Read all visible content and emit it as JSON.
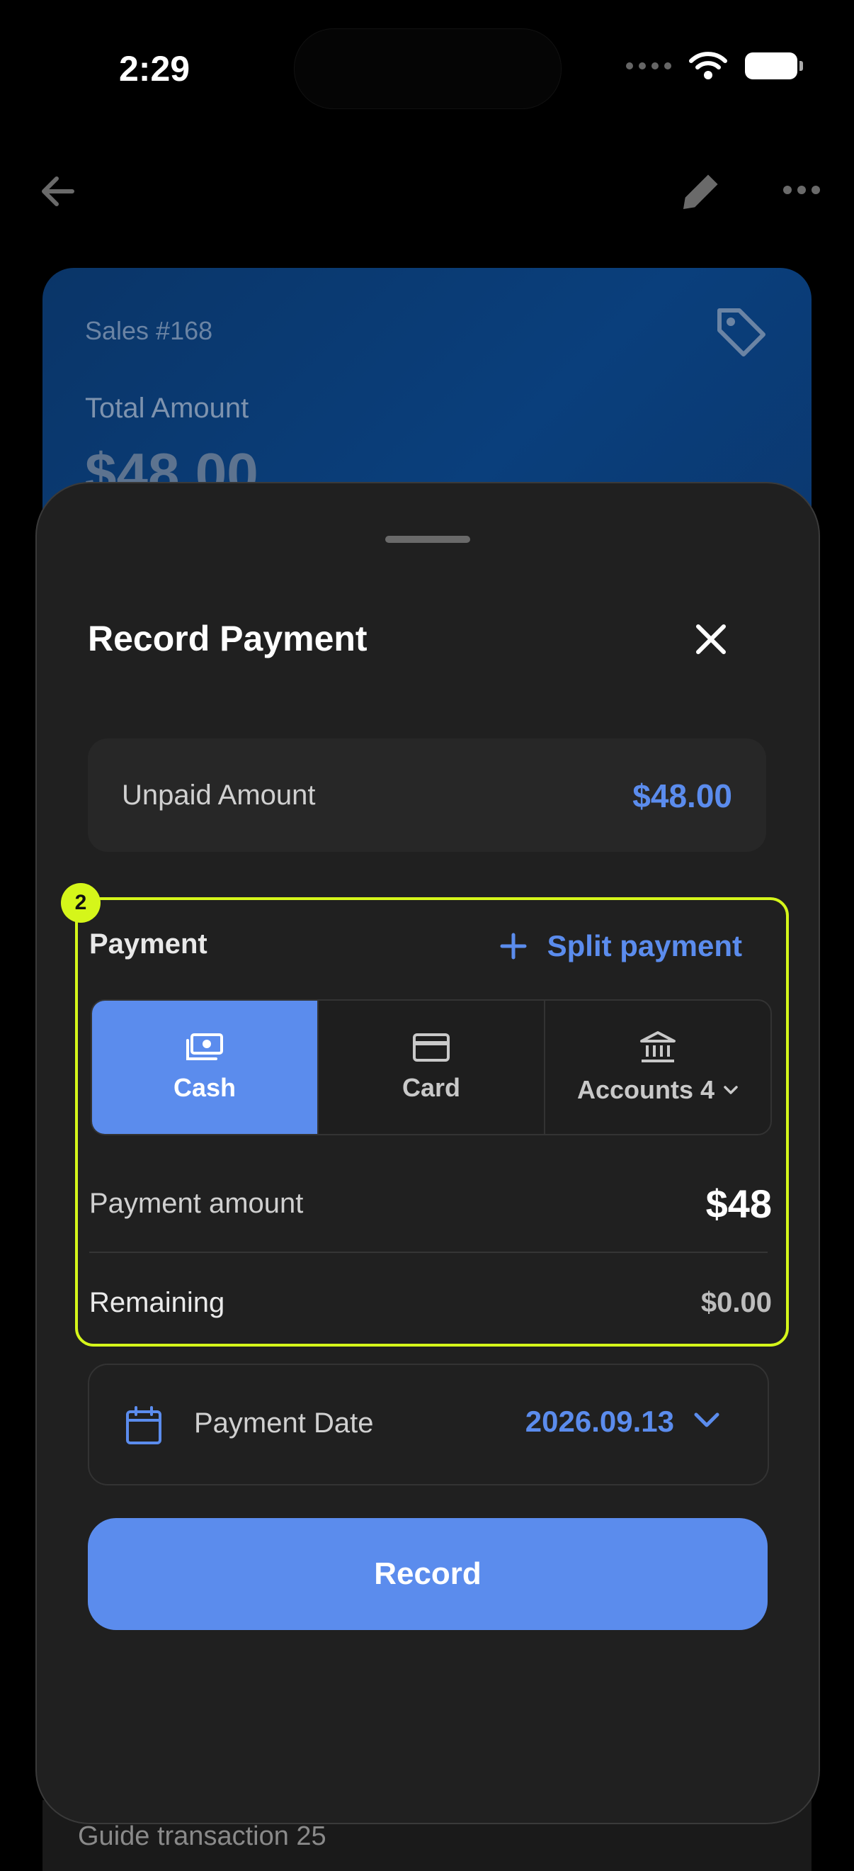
{
  "status_bar": {
    "time": "2:29"
  },
  "background": {
    "card": {
      "subtitle": "Sales #168",
      "label": "Total Amount",
      "amount": "$48.00"
    },
    "list_item_text": "Guide transaction 25"
  },
  "sheet": {
    "title": "Record Payment",
    "unpaid": {
      "label": "Unpaid Amount",
      "value": "$48.00"
    },
    "payment": {
      "badge": "2",
      "title": "Payment",
      "split_label": "Split payment",
      "methods": [
        {
          "label": "Cash",
          "icon": "cash-icon",
          "active": true
        },
        {
          "label": "Card",
          "icon": "card-icon",
          "active": false
        },
        {
          "label": "Accounts 4",
          "icon": "bank-icon",
          "active": false
        }
      ],
      "amount_label": "Payment amount",
      "amount_value": "$48",
      "remaining_label": "Remaining",
      "remaining_value": "$0.00"
    },
    "date": {
      "label": "Payment Date",
      "value": "2026.09.13"
    },
    "record_label": "Record"
  },
  "colors": {
    "accent": "#5b8ced",
    "highlight": "#d5f61a",
    "sheet_bg": "#202020",
    "card_bg": "#0a3a72"
  }
}
